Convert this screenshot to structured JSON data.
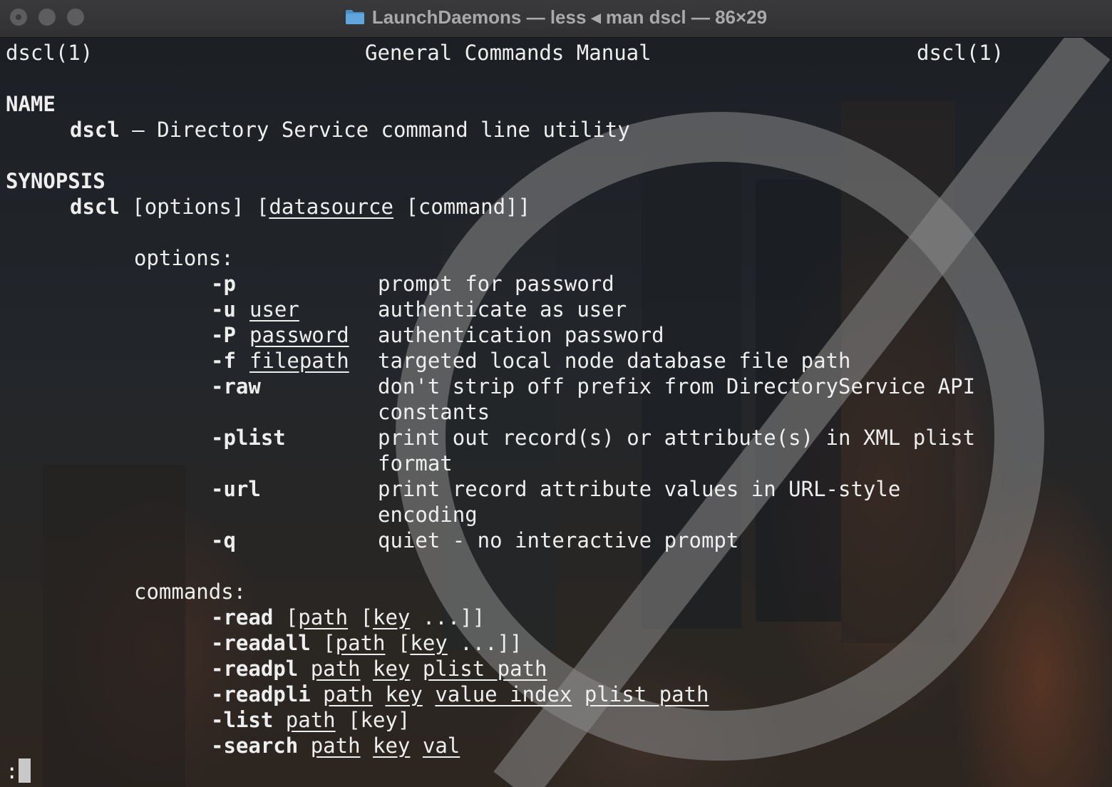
{
  "window": {
    "title": "LaunchDaemons — less ◂ man dscl — 86×29"
  },
  "man": {
    "header": {
      "left": "dscl(1)",
      "center": "General Commands Manual",
      "right": "dscl(1)"
    },
    "name_section": {
      "heading": "NAME",
      "cmd": "dscl",
      "desc": " – Directory Service command line utility"
    },
    "synopsis": {
      "heading": "SYNOPSIS",
      "cmd": "dscl",
      "t1": " [options] [",
      "datasource": "datasource",
      "t2": " [command]]"
    },
    "options": {
      "heading": "options:",
      "items": [
        {
          "flag": "-p",
          "arg": "",
          "desc": "prompt for password"
        },
        {
          "flag": "-u",
          "arg": "user",
          "desc": "authenticate as user"
        },
        {
          "flag": "-P",
          "arg": "password",
          "desc": "authentication password"
        },
        {
          "flag": "-f",
          "arg": "filepath",
          "desc": "targeted local node database file path"
        },
        {
          "flag": "-raw",
          "arg": "",
          "desc": "don't strip off prefix from DirectoryService API",
          "desc2": "constants"
        },
        {
          "flag": "-plist",
          "arg": "",
          "desc": "print out record(s) or attribute(s) in XML plist",
          "desc2": "format"
        },
        {
          "flag": "-url",
          "arg": "",
          "desc": "print record attribute values in URL-style",
          "desc2": "encoding"
        },
        {
          "flag": "-q",
          "arg": "",
          "desc": "quiet - no interactive prompt"
        }
      ]
    },
    "commands": {
      "heading": "commands:",
      "read": {
        "flag": "-read",
        "t1": " [",
        "path": "path",
        "t2": " [",
        "key": "key",
        "t3": " ...]]"
      },
      "readall": {
        "flag": "-readall",
        "t1": " [",
        "path": "path",
        "t2": " [",
        "key": "key",
        "t3": " ...]]"
      },
      "readpl": {
        "flag": "-readpl",
        "path": "path",
        "key": "key",
        "plist_path": "plist_path"
      },
      "readpli": {
        "flag": "-readpli",
        "path": "path",
        "key": "key",
        "value_index": "value_index",
        "plist_path": "plist_path"
      },
      "list": {
        "flag": "-list",
        "path": "path",
        "t1": " [key]"
      },
      "search": {
        "flag": "-search",
        "path": "path",
        "key": "key",
        "val": "val"
      }
    },
    "prompt": ":"
  }
}
